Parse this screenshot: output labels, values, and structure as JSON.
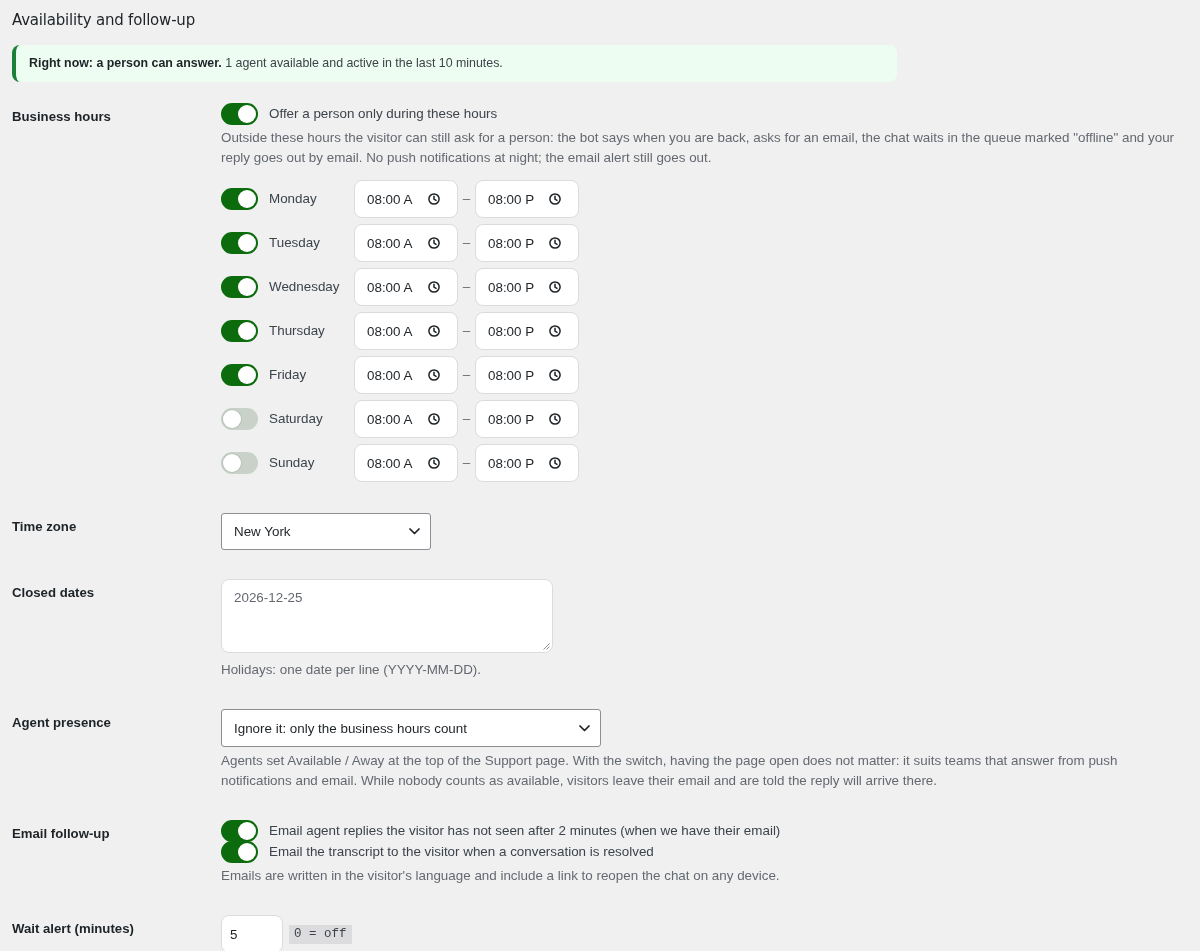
{
  "section": {
    "title": "Availability and follow-up"
  },
  "notice": {
    "text": "**Right now: a person can answer.** 1 agent available and active in the last 10 minutes."
  },
  "business_hours": {
    "label": "Business hours",
    "toggle": {
      "label": "Offer a person only during these hours",
      "on": true
    },
    "description": "Outside these hours the visitor can still ask for a person: the bot says when you are back, asks for an email, the chat waits in the queue marked \"offline\" and your reply goes out by email. No push notifications at night; the email alert still goes out.",
    "days": [
      {
        "name": "Monday",
        "on": true,
        "start": "08:00 A",
        "separator": "–",
        "end": "08:00 P"
      },
      {
        "name": "Tuesday",
        "on": true,
        "start": "08:00 A",
        "separator": "–",
        "end": "08:00 P"
      },
      {
        "name": "Wednesday",
        "on": true,
        "start": "08:00 A",
        "separator": "–",
        "end": "08:00 P"
      },
      {
        "name": "Thursday",
        "on": true,
        "start": "08:00 A",
        "separator": "–",
        "end": "08:00 P"
      },
      {
        "name": "Friday",
        "on": true,
        "start": "08:00 A",
        "separator": "–",
        "end": "08:00 P"
      },
      {
        "name": "Saturday",
        "on": false,
        "start": "08:00 A",
        "separator": "–",
        "end": "08:00 P"
      },
      {
        "name": "Sunday",
        "on": false,
        "start": "08:00 A",
        "separator": "–",
        "end": "08:00 P"
      }
    ]
  },
  "time_zone": {
    "label": "Time zone",
    "value": "New York"
  },
  "closed_dates": {
    "label": "Closed dates",
    "placeholder": "2026-12-25",
    "hint": "Holidays: one date per line (YYYY-MM-DD)."
  },
  "agent_presence": {
    "label": "Agent presence",
    "value": "Ignore it: only the business hours count",
    "description": "Agents set Available / Away at the top of the Support page. With the switch, having the page open does not matter: it suits teams that answer from push notifications and email. While nobody counts as available, visitors leave their email and are told the reply will arrive there."
  },
  "email_follow_up": {
    "label": "Email follow-up",
    "options": [
      {
        "label": "Email agent replies the visitor has not seen after 2 minutes (when we have their email)",
        "on": true
      },
      {
        "label": "Email the transcript to the visitor when a conversation is resolved",
        "on": true
      }
    ],
    "description": "Emails are written in the visitor's language and include a link to reopen the chat on any device."
  },
  "wait_alert": {
    "label": "Wait alert (minutes)",
    "value": "5",
    "hint": "0 = off"
  }
}
